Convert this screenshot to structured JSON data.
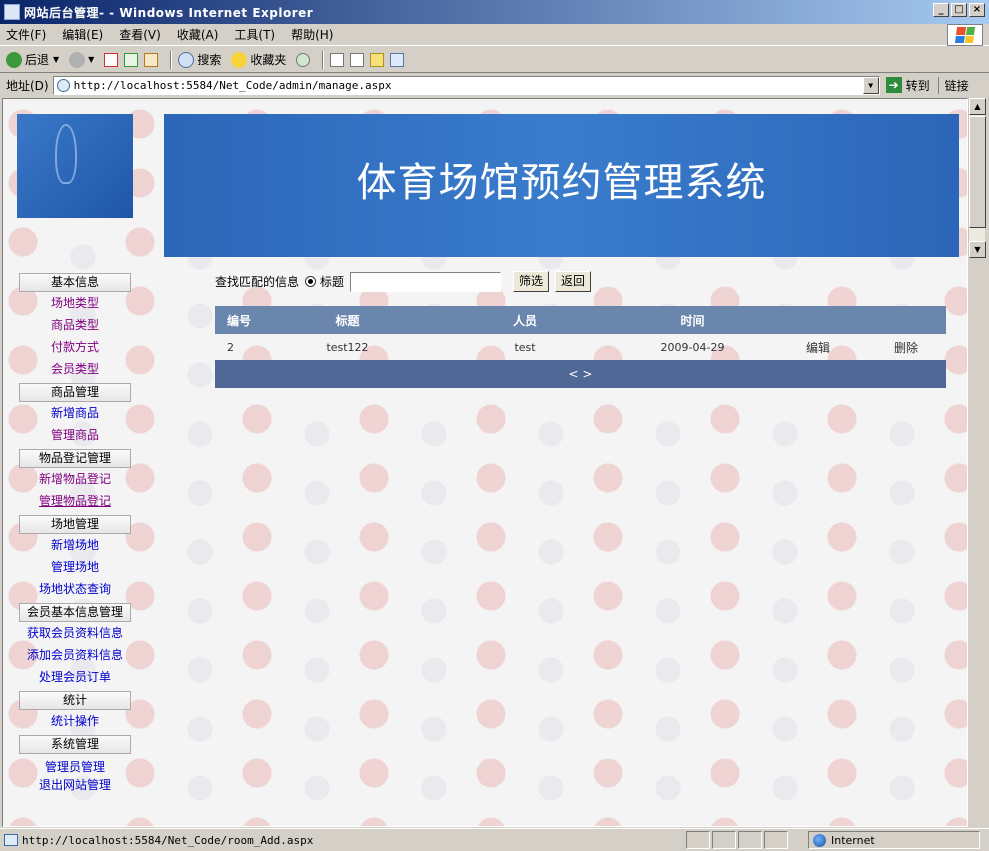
{
  "window": {
    "title": "网站后台管理- - Windows Internet Explorer"
  },
  "menu": {
    "items": [
      "文件(F)",
      "编辑(E)",
      "查看(V)",
      "收藏(A)",
      "工具(T)",
      "帮助(H)"
    ]
  },
  "toolbar": {
    "back": "后退",
    "search": "搜索",
    "favorites": "收藏夹"
  },
  "address": {
    "label": "地址(D)",
    "url": "http://localhost:5584/Net_Code/admin/manage.aspx",
    "go": "转到",
    "links": "链接"
  },
  "banner": {
    "title": "体育场馆预约管理系统"
  },
  "sidebar": {
    "groups": [
      {
        "heading": "基本信息",
        "links": [
          "场地类型",
          "商品类型",
          "付款方式",
          "会员类型"
        ]
      },
      {
        "heading": "商品管理",
        "links": [
          "新增商品",
          "管理商品"
        ]
      },
      {
        "heading": "物品登记管理",
        "links": [
          "新增物品登记",
          "管理物品登记"
        ]
      },
      {
        "heading": "场地管理",
        "links": [
          "新增场地",
          "管理场地",
          "场地状态查询"
        ]
      },
      {
        "heading": "会员基本信息管理",
        "links": [
          "获取会员资料信息",
          "添加会员资料信息",
          "处理会员订单"
        ]
      },
      {
        "heading": "统计",
        "links": [
          "统计操作"
        ]
      },
      {
        "heading": "系统管理",
        "links": [
          "管理员管理",
          "退出网站管理"
        ]
      }
    ]
  },
  "search": {
    "label": "查找匹配的信息",
    "radio_label": "标题",
    "value": "",
    "filter_btn": "筛选",
    "back_btn": "返回"
  },
  "table": {
    "headers": [
      "编号",
      "标题",
      "人员",
      "时间",
      "",
      ""
    ],
    "rows": [
      {
        "id": "2",
        "title": "test122",
        "person": "test",
        "date": "2009-04-29",
        "edit": "编辑",
        "delete": "删除"
      }
    ],
    "pager": "< >"
  },
  "status": {
    "url": "http://localhost:5584/Net_Code/room_Add.aspx",
    "zone": "Internet"
  }
}
